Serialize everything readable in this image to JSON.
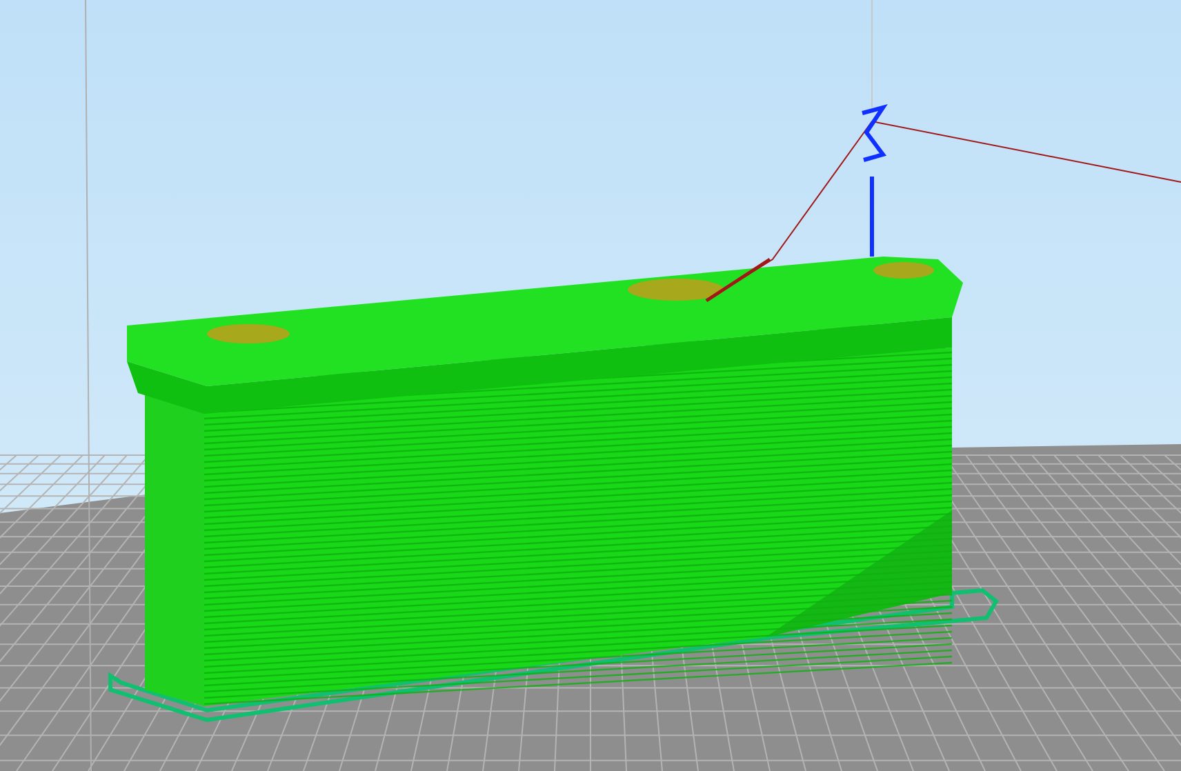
{
  "viewport": {
    "kind": "print-preview"
  }
}
